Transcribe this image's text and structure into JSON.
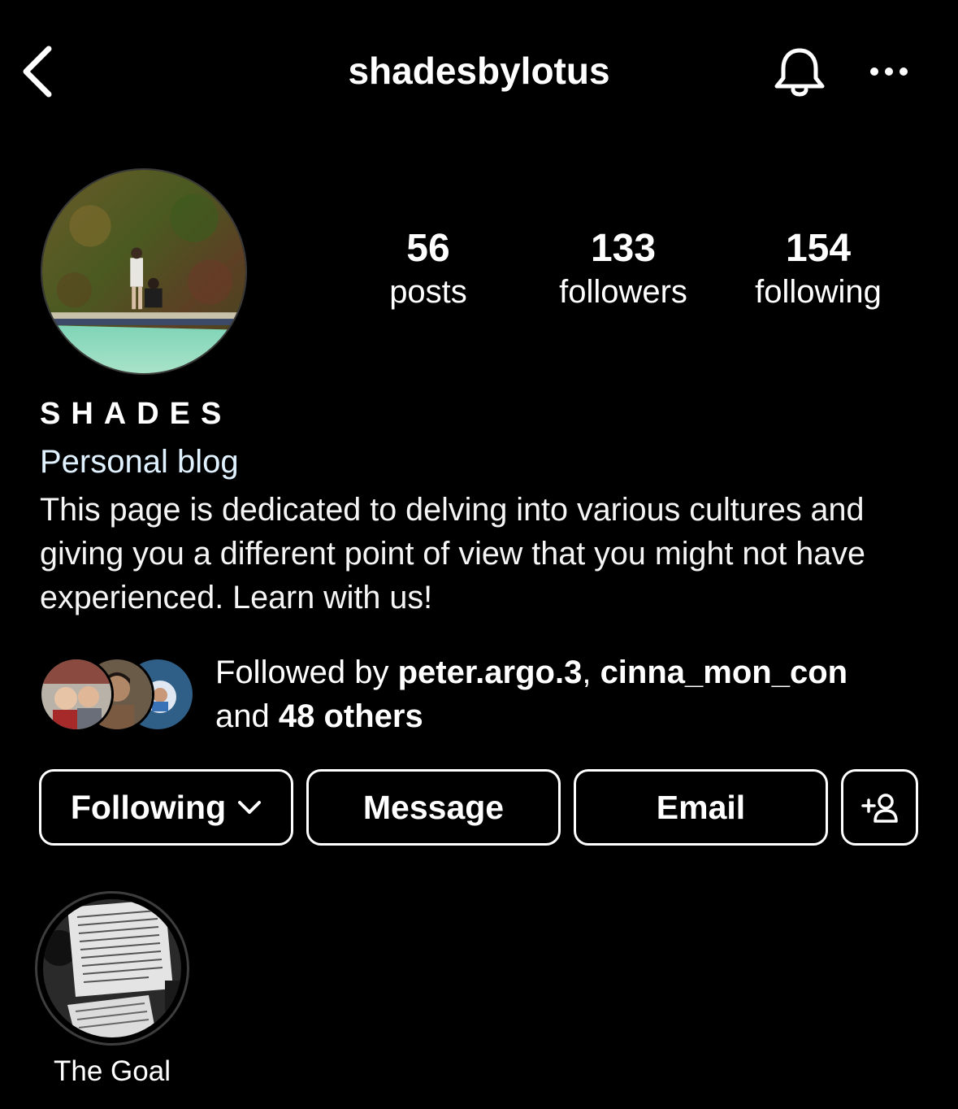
{
  "header": {
    "username": "shadesbylotus",
    "back_icon": "chevron-left-icon",
    "bell_icon": "bell-icon",
    "more_icon": "more-horizontal-icon"
  },
  "profile": {
    "avatar": "profile-photo",
    "display_name": "SHADES",
    "category": "Personal blog",
    "bio": "This page is dedicated to delving into various cultures and giving you a different point of view that you might not have experienced. Learn with us!"
  },
  "stats": {
    "posts": {
      "value": "56",
      "label": "posts"
    },
    "followers": {
      "value": "133",
      "label": "followers"
    },
    "following": {
      "value": "154",
      "label": "following"
    }
  },
  "followed_by": {
    "prefix": "Followed by ",
    "user1": "peter.argo.3",
    "separator": ", ",
    "user2": "cinna_mon_con",
    "and_text": "and ",
    "others": "48 others"
  },
  "buttons": {
    "following": "Following",
    "message": "Message",
    "email": "Email",
    "add_user_icon": "add-user-icon"
  },
  "highlights": [
    {
      "label": "The Goal"
    }
  ],
  "colors": {
    "background": "#000000",
    "text": "#ffffff",
    "category": "#e0f1ff"
  }
}
